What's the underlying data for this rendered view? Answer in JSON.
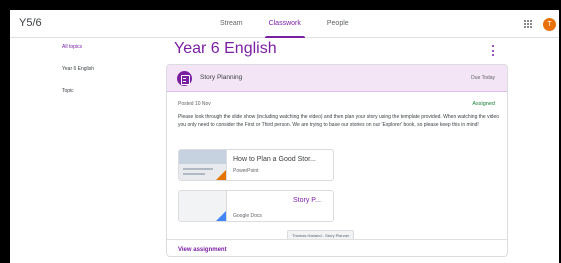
{
  "header": {
    "class_name": "Y5/6",
    "tabs": [
      {
        "label": "Stream",
        "active": false
      },
      {
        "label": "Classwork",
        "active": true
      },
      {
        "label": "People",
        "active": false
      }
    ],
    "avatar_initial": "T",
    "accent_color": "#7b1fa2",
    "avatar_color": "#e8710a"
  },
  "sidebar": {
    "items": [
      {
        "label": "All topics",
        "active": true
      },
      {
        "label": "Year 6 English",
        "active": false
      },
      {
        "label": "Topic",
        "active": false
      }
    ]
  },
  "main": {
    "title": "Year 6 English"
  },
  "assignment": {
    "title": "Story Planning",
    "due": "Due Today",
    "posted": "Posted 10 Nov",
    "status": "Assigned",
    "instructions": "Please look through the slide show (including watching the video) and then plan your story using the template provided. When watching the video you only need to consider the First or Third person. We are trying to base our stories on our 'Explorer' book, so please keep this in mind!",
    "attachments": [
      {
        "name": "How to Plan a Good Stor...",
        "type": "PowerPoint",
        "icon": "powerpoint-thumbnail"
      },
      {
        "name": "Story P...",
        "type": "Google Docs",
        "icon": "google-docs-thumbnail"
      }
    ],
    "tooltip": "Thomas Harland - Story Planner",
    "view_link": "View assignment"
  }
}
